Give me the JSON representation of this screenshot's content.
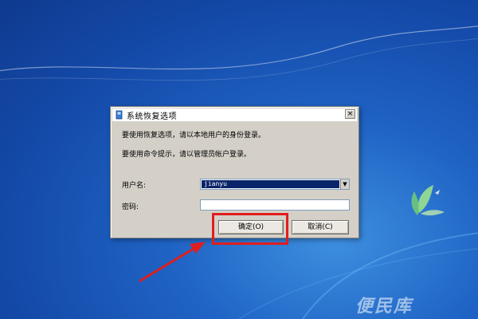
{
  "dialog": {
    "title": "系统恢复选项",
    "close_label": "×",
    "message_1": "要使用恢复选项，请以本地用户的身份登录。",
    "message_2": "要使用命令提示，请以管理员帐户登录。",
    "username_label": "用户名:",
    "username_value": "jianyu",
    "password_label": "密码:",
    "password_value": "",
    "ok_label": "确定(O)",
    "cancel_label": "取消(C)"
  },
  "watermark": {
    "text": "便民库"
  },
  "colors": {
    "highlight": "#e01e1e",
    "selection": "#0a246a",
    "desktop": "#1f63c4"
  },
  "icons": {
    "dialog_icon": "system-recovery-icon",
    "combo_arrow": "chevron-down-icon"
  }
}
